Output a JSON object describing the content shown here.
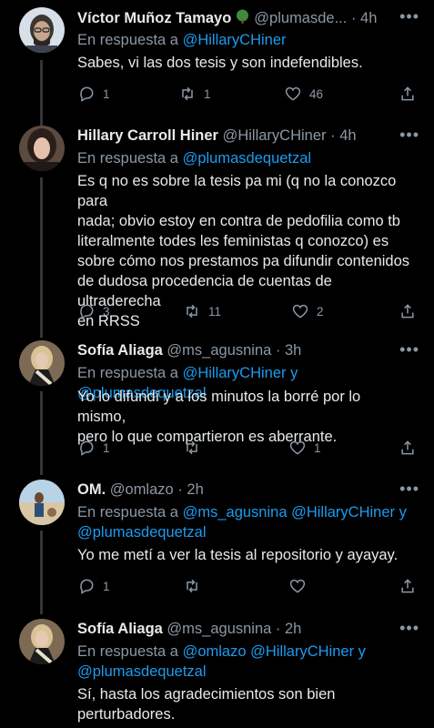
{
  "tweets": [
    {
      "name": "Víctor Muñoz Tamayo",
      "handle": "@plumasde...",
      "time": "· 4h",
      "reply_prefix": "En respuesta a",
      "reply_to": "@HillaryCHiner",
      "reply_mid": "",
      "reply_to2": "",
      "reply_mid2": "",
      "reply_to3": "",
      "lines": [
        "Sabes, vi las dos tesis y son indefendibles."
      ],
      "replies": "1",
      "retweets": "1",
      "likes": "46"
    },
    {
      "name": "Hillary Carroll Hiner",
      "handle": "@HillaryCHiner",
      "time": "· 4h",
      "reply_prefix": "En respuesta a",
      "reply_to": "@plumasdequetzal",
      "reply_mid": "",
      "reply_to2": "",
      "reply_mid2": "",
      "reply_to3": "",
      "lines": [
        "Es q no es sobre la tesis pa mi (q no la conozco para",
        "nada; obvio estoy en contra de pedofilia como tb",
        "literalmente todes les feministas q conozco) es",
        "sobre cómo nos prestamos pa difundir contenidos",
        "de dudosa procedencia de cuentas de ultraderecha",
        "en RRSS"
      ],
      "replies": "3",
      "retweets": "11",
      "likes": "2"
    },
    {
      "name": "Sofía Aliaga",
      "handle": "@ms_agusnina",
      "time": "· 3h",
      "reply_prefix": "En respuesta a",
      "reply_to": "@HillaryCHiner",
      "reply_mid": " y ",
      "reply_to2": "@plumasdequetzal",
      "reply_mid2": "",
      "reply_to3": "",
      "lines": [
        "Yo lo difundí y a los minutos la borré por lo mismo,",
        "pero lo que compartieron es aberrante."
      ],
      "replies": "1",
      "retweets": "",
      "likes": "1"
    },
    {
      "name": "OM.",
      "handle": "@omlazo",
      "time": "· 2h",
      "reply_prefix": "En respuesta a",
      "reply_to": "@ms_agusnina",
      "reply_mid": " ",
      "reply_to2": "@HillaryCHiner",
      "reply_mid2": " y",
      "reply_to3": "@plumasdequetzal",
      "lines": [
        "Yo me metí a ver la tesis al repositorio y ayayay."
      ],
      "replies": "1",
      "retweets": "",
      "likes": ""
    },
    {
      "name": "Sofía Aliaga",
      "handle": "@ms_agusnina",
      "time": "· 2h",
      "reply_prefix": "En respuesta a",
      "reply_to": "@omlazo",
      "reply_mid": " ",
      "reply_to2": "@HillaryCHiner",
      "reply_mid2": " y",
      "reply_to3": "@plumasdequetzal",
      "lines": [
        "Sí, hasta los agradecimientos son bien",
        "perturbadores."
      ],
      "replies": "",
      "retweets": "",
      "likes": ""
    }
  ],
  "colors": {
    "background": "#000000",
    "text": "#e7e9ea",
    "secondary": "#8b98a5",
    "link": "#1d9bf0",
    "thread_line": "#333639"
  }
}
